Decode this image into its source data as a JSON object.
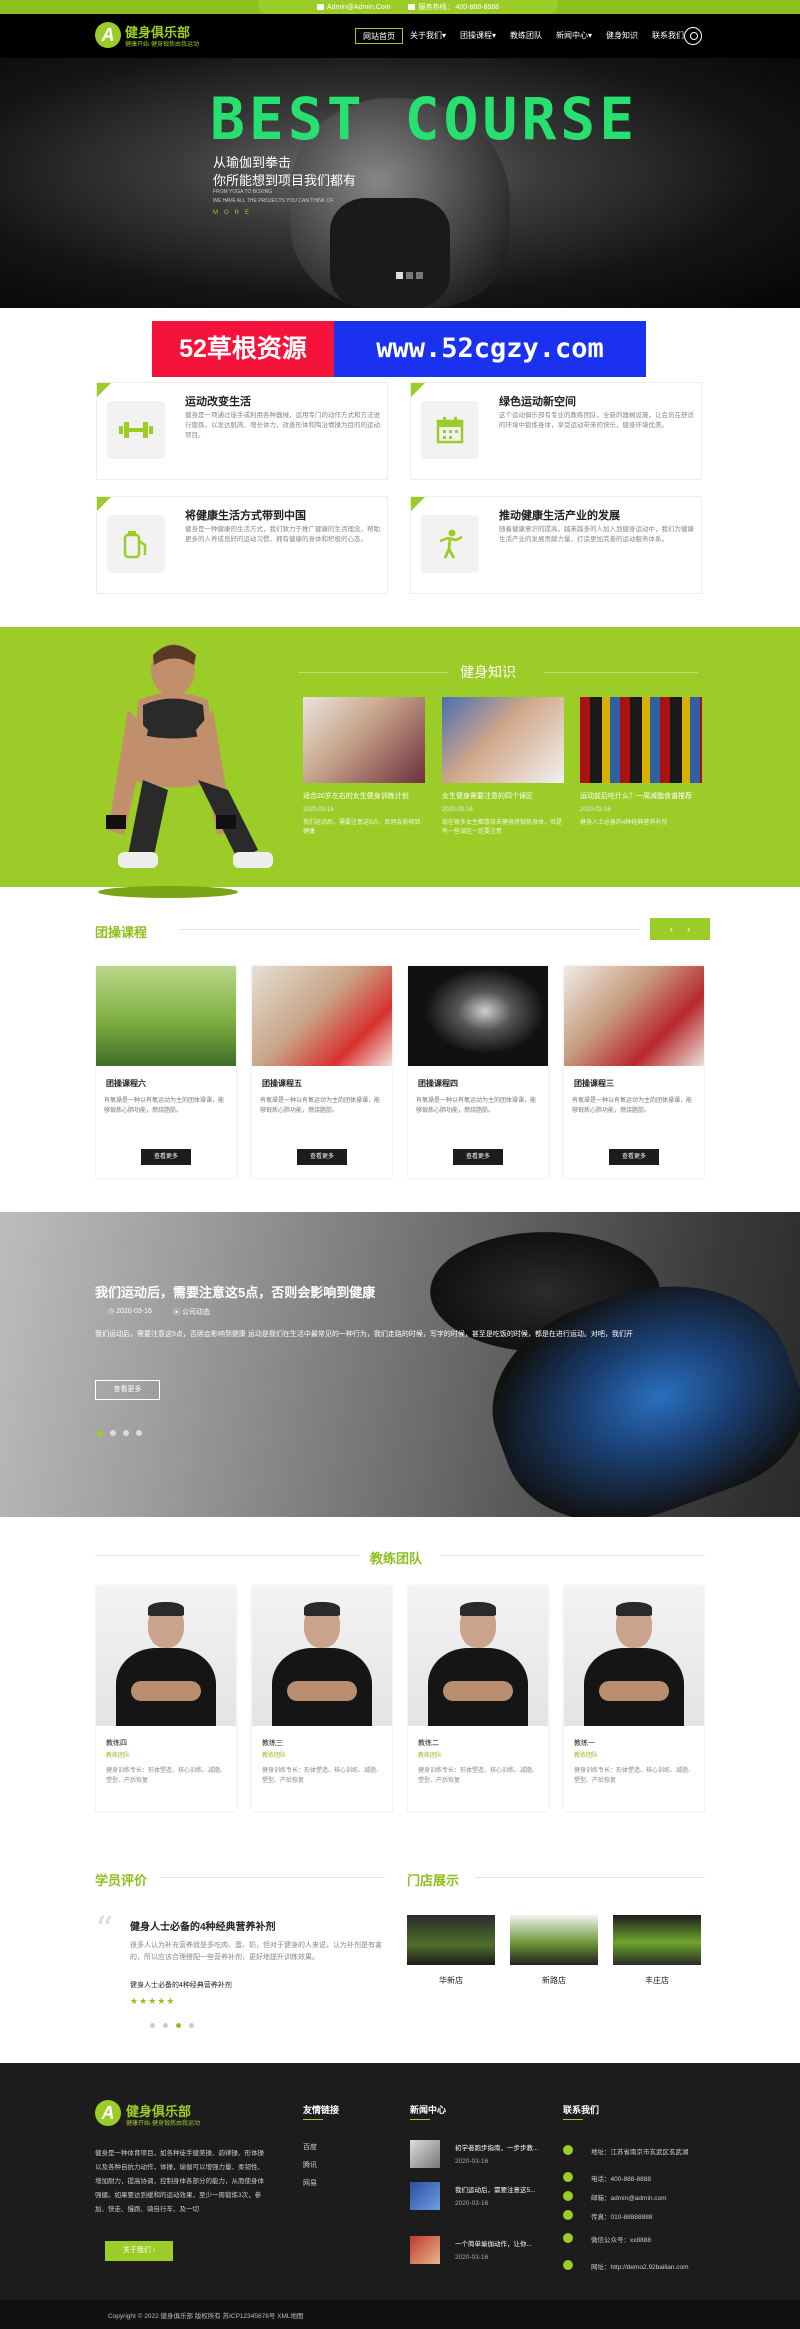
{
  "topbar": {
    "email": "Admin@Admin.Com",
    "phone_label": "服务热线：",
    "phone": "400-888-8888"
  },
  "header": {
    "logo_letter": "A",
    "title": "健身俱乐部",
    "tagline": "健康开始·健身锻炼由我运动"
  },
  "nav": {
    "items": [
      "网站首页",
      "关于我们",
      "团操课程",
      "教练团队",
      "新闻中心",
      "健身知识",
      "联系我们"
    ],
    "active_index": 0
  },
  "hero": {
    "title": "BEST COURSE",
    "cn_line1": "从瑜伽到拳击",
    "cn_line2": "你所能想到项目我们都有",
    "en_line1": "FROM YOGA TO BOXING",
    "en_line2": "WE HAVE ALL THE PROJECTS YOU CAN THINK OF",
    "more": "MORE"
  },
  "watermark": {
    "left": "52草根资源",
    "right": "www.52cgzy.com"
  },
  "features": [
    {
      "title": "运动改变生活",
      "icon": "dumbbell-icon",
      "desc": "健身是一项通过徒手或利用各种器械，运用专门的动作方式和方法进行锻炼，以发达肌肉、增长体力、改善形体和陶冶情操为目的的运动项目。"
    },
    {
      "title": "绿色运动新空间",
      "icon": "calendar-icon",
      "desc": "这个运动俱乐部有专业的教练团队，全新的器械设施，让会员在舒适的环境中锻炼身体，享受运动带来的快乐，健身环境优美。"
    },
    {
      "title": "将健康生活方式带到中国",
      "icon": "fuel-icon",
      "desc": "健身是一种健康的生活方式，我们致力于推广健康的生活理念，帮助更多的人养成良好的运动习惯，拥有健康的身体和积极的心态。"
    },
    {
      "title": "推动健康生活产业的发展",
      "icon": "runner-icon",
      "desc": "随着健康意识的提高，越来越多的人加入到健身运动中，我们为健康生活产业的发展贡献力量，打造更加完善的运动服务体系。"
    }
  ],
  "knowledge": {
    "title": "健身知识",
    "items": [
      {
        "title": "适合20岁左右的女生健身训练计划",
        "date": "2020-03-16",
        "desc": "我们运动后，需要注意这5点，否则会影响到健康"
      },
      {
        "title": "女生健身需要注意的四个误区",
        "date": "2020-03-16",
        "desc": "现在很多女生都喜欢去健身房锻炼身体，但是有一些误区一定要注意"
      },
      {
        "title": "运动前后吃什么？一周减脂食谱推荐",
        "date": "2020-03-16",
        "desc": "健身人士必备的4种经典营养补剂"
      }
    ]
  },
  "courses": {
    "title": "团操课程",
    "arrows": [
      "‹",
      "›"
    ],
    "btn": "查看更多",
    "items": [
      {
        "title": "团操课程六",
        "desc": "有氧操是一种以有氧运动为主的团体操课，能够锻炼心肺功能，燃烧脂肪。"
      },
      {
        "title": "团操课程五",
        "desc": "有氧操是一种以有氧运动为主的团体操课，能够锻炼心肺功能，燃烧脂肪。"
      },
      {
        "title": "团操课程四",
        "desc": "有氧操是一种以有氧运动为主的团体操课，能够锻炼心肺功能，燃烧脂肪。"
      },
      {
        "title": "团操课程三",
        "desc": "有氧操是一种以有氧运动为主的团体操课，能够锻炼心肺功能，燃烧脂肪。"
      }
    ]
  },
  "article": {
    "title": "我们运动后，需要注意这5点，否则会影响到健康",
    "date": "2020-03-16",
    "category": "公司动态",
    "desc": "我们运动后，需要注意这5点，否则会影响到健康 运动是我们在生活中最常见的一种行为，我们走路的时候，写字的时候，甚至是吃饭的时候，都是在进行运动。对吧，我们开",
    "btn": "查看更多"
  },
  "coaches": {
    "title": "教练团队",
    "items": [
      {
        "name": "教练四",
        "role": "教练团队",
        "desc": "健身训练专长：形体塑造、核心训练、减脂、塑型、产后恢复"
      },
      {
        "name": "教练三",
        "role": "教练团队",
        "desc": "健身训练专长：形体塑造、核心训练、减脂、塑型、产后恢复"
      },
      {
        "name": "教练二",
        "role": "教练团队",
        "desc": "健身训练专长：形体塑造、核心训练、减脂、塑型、产后恢复"
      },
      {
        "name": "教练一",
        "role": "教练团队",
        "desc": "健身训练专长：形体塑造、核心训练、减脂、塑型、产后恢复"
      }
    ]
  },
  "reviews": {
    "title": "学员评价",
    "headline": "健身人士必备的4种经典营养补剂",
    "text": "很多人认为补充营养就是多吃肉、蛋、奶，但对于健身的人来说，认为补剂是有害的，所以应该合理搭配一些营养补剂，更好地提升训练效果。",
    "sub": "健身人士必备的4种经典营养补剂",
    "stars": "★★★★★",
    "quote": "“"
  },
  "stores": {
    "title": "门店展示",
    "items": [
      "华新店",
      "新路店",
      "丰庄店"
    ]
  },
  "footer": {
    "logo_letter": "A",
    "title": "健身俱乐部",
    "tagline": "健康开始·健身锻炼由我运动",
    "desc": "健身是一种体育项目，如各种徒手健美操、韵律操、形体操以及各种自抗力动作，体操，瑜伽可以增强力量、柔韧性、增加耐力，提高协调，控制身体各部分的能力，从而使身体强健。如果要达到缓和的运动效果，至少一周锻炼3次，参加、快走、慢跑、骑自行车、及一切",
    "about_btn": "关于我们",
    "links_title": "友情链接",
    "links": [
      "百度",
      "腾讯",
      "网易"
    ],
    "news_title": "新闻中心",
    "news": [
      {
        "title": "初学者跑步指南，一步步教...",
        "date": "2020-03-16"
      },
      {
        "title": "我们运动后，需要注意这5...",
        "date": "2020-03-16"
      },
      {
        "title": "一个简单瑜伽动作，让你...",
        "date": "2020-03-16"
      }
    ],
    "contact_title": "联系我们",
    "contacts": [
      "地址：江苏省南京市玄武区玄武湖",
      "电话：400-888-8888",
      "邮箱：admin@admin.com",
      "传真：010-88888888",
      "微信公众号：xx8888",
      "网址：http://demo2.92bailian.com"
    ],
    "copyright": "Copyright © 2022 健身俱乐部 版权所有 苏ICP12345678号 XML地图"
  },
  "colors": {
    "accent": "#9ccc27",
    "accent_dark": "#8fbf1f",
    "footer_bg": "#1c1c1c"
  }
}
